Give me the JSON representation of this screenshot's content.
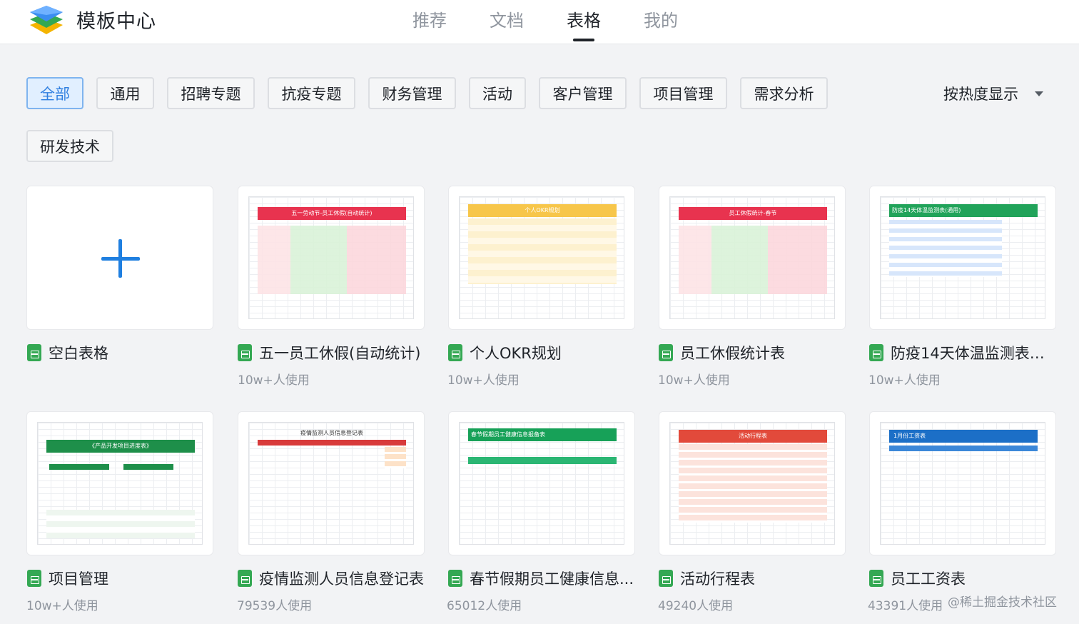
{
  "header": {
    "brand": "模板中心",
    "nav": [
      {
        "label": "推荐",
        "active": false
      },
      {
        "label": "文档",
        "active": false
      },
      {
        "label": "表格",
        "active": true
      },
      {
        "label": "我的",
        "active": false
      }
    ]
  },
  "filters": {
    "chips": [
      {
        "label": "全部",
        "active": true
      },
      {
        "label": "通用",
        "active": false
      },
      {
        "label": "招聘专题",
        "active": false
      },
      {
        "label": "抗疫专题",
        "active": false
      },
      {
        "label": "财务管理",
        "active": false
      },
      {
        "label": "活动",
        "active": false
      },
      {
        "label": "客户管理",
        "active": false
      },
      {
        "label": "项目管理",
        "active": false
      },
      {
        "label": "需求分析",
        "active": false
      },
      {
        "label": "研发技术",
        "active": false
      }
    ],
    "sort_label": "按热度显示"
  },
  "templates": [
    {
      "title": "空白表格",
      "usage": "",
      "thumb_type": "blank",
      "icon": "sheet-icon"
    },
    {
      "title": "五一员工休假(自动统计)",
      "usage": "10w+人使用",
      "thumb_type": "leave",
      "banner": "五一劳动节-员工休假(自动统计)",
      "accent": "#e8334f",
      "icon": "sheet-icon"
    },
    {
      "title": "个人OKR规划",
      "usage": "10w+人使用",
      "thumb_type": "okr",
      "banner": "个人OKR规划",
      "accent": "#f7c64a",
      "icon": "sheet-icon"
    },
    {
      "title": "员工休假统计表",
      "usage": "10w+人使用",
      "thumb_type": "leave",
      "banner": "员工休假统计-春节",
      "accent": "#e8334f",
      "icon": "sheet-icon"
    },
    {
      "title": "防疫14天体温监测表(...",
      "usage": "10w+人使用",
      "thumb_type": "temp",
      "banner": "防疫14天体温监测表(通用)",
      "accent": "#21a35a",
      "icon": "sheet-icon"
    },
    {
      "title": "项目管理",
      "usage": "10w+人使用",
      "thumb_type": "project",
      "banner": "《产品开发项目进度表》",
      "accent": "#1e8f4a",
      "icon": "sheet-icon"
    },
    {
      "title": "疫情监测人员信息登记表",
      "usage": "79539人使用",
      "thumb_type": "register",
      "banner": "疫情监测人员信息登记表",
      "accent": "#d83b3b",
      "icon": "sheet-icon"
    },
    {
      "title": "春节假期员工健康信息...",
      "usage": "65012人使用",
      "thumb_type": "health",
      "banner": "春节假期员工健康信息报备表",
      "accent": "#17a158",
      "icon": "sheet-icon"
    },
    {
      "title": "活动行程表",
      "usage": "49240人使用",
      "thumb_type": "schedule",
      "banner": "活动行程表",
      "accent": "#e24a3b",
      "icon": "sheet-icon"
    },
    {
      "title": "员工工资表",
      "usage": "43391人使用",
      "thumb_type": "salary",
      "banner": "1月份工资表",
      "accent": "#1c6fc7",
      "icon": "sheet-icon"
    }
  ],
  "watermark": "@稀土掘金技术社区",
  "colors": {
    "accent_blue": "#2f7fe0",
    "background": "#f2f3f5",
    "sheet_green": "#34a853"
  }
}
